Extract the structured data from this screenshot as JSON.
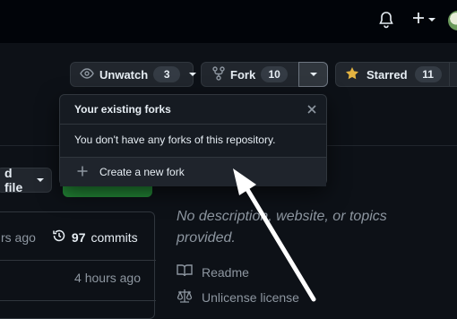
{
  "header": {
    "actions": [
      "notifications",
      "create-new",
      "avatar"
    ]
  },
  "repo_actions": {
    "unwatch": {
      "label": "Unwatch",
      "count": "3"
    },
    "fork": {
      "label": "Fork",
      "count": "10"
    },
    "star": {
      "label": "Starred",
      "count": "11"
    }
  },
  "fork_dropdown": {
    "title": "Your existing forks",
    "message": "You don't have any forks of this repository.",
    "create_label": "Create a new fork"
  },
  "file_bar": {
    "add_file_label": "d file"
  },
  "commits": {
    "time": "rs ago",
    "count": "97",
    "label": "commits",
    "row_time": "4 hours ago"
  },
  "about": {
    "description": "No description, website, or topics provided.",
    "readme_label": "Readme",
    "license_label": "Unlicense license"
  },
  "colors": {
    "bg": "#0d1117",
    "accent_green": "#238636",
    "star": "#e3b341"
  },
  "icons": [
    "bell-icon",
    "plus-icon",
    "eye-icon",
    "fork-icon",
    "star-icon",
    "close-icon",
    "history-icon",
    "book-icon",
    "law-icon"
  ]
}
